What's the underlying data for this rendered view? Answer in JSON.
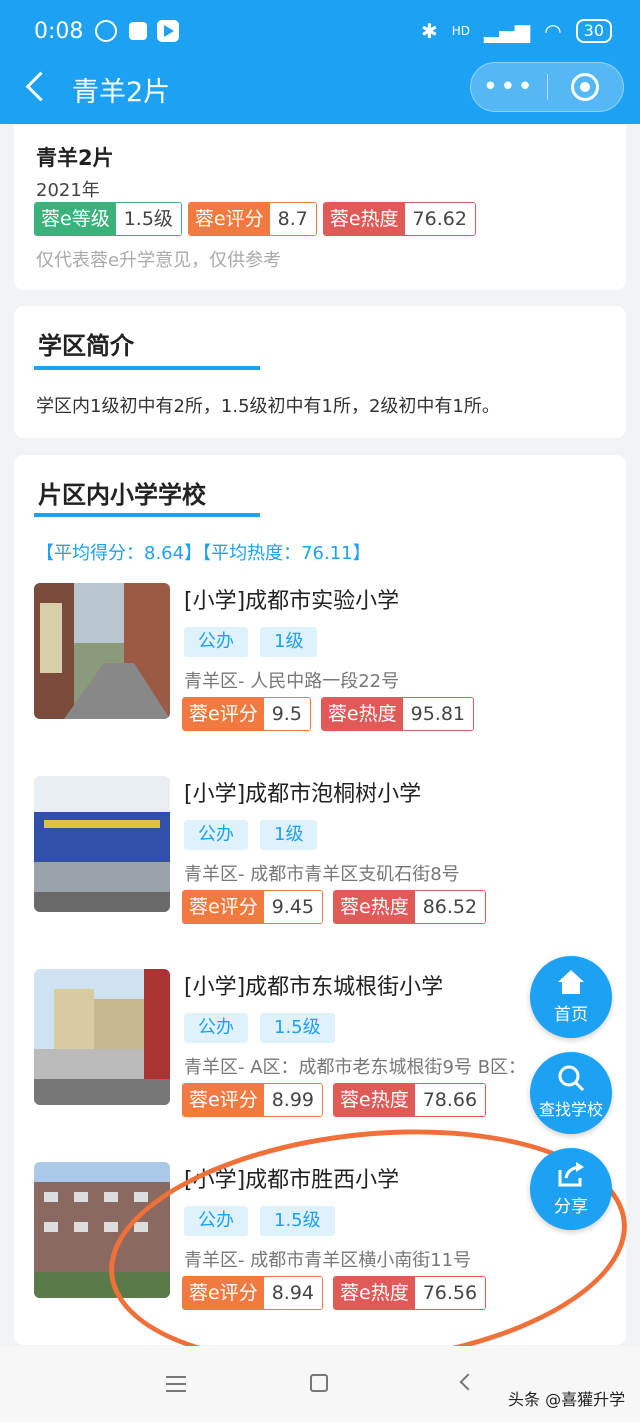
{
  "status_bar": {
    "time": "0:08",
    "network": "HD",
    "battery": "30"
  },
  "navbar": {
    "title": "青羊2片",
    "more_label": "•••"
  },
  "summary": {
    "title": "青羊2片",
    "year": "2021年",
    "badges": [
      {
        "key": "蓉e等级",
        "value": "1.5级"
      },
      {
        "key": "蓉e评分",
        "value": "8.7"
      },
      {
        "key": "蓉e热度",
        "value": "76.62"
      }
    ],
    "note": "仅代表蓉e升学意见，仅供参考"
  },
  "district_intro": {
    "title": "学区简介",
    "text": "学区内1级初中有2所，1.5级初中有1所，2级初中有1所。"
  },
  "primary_schools": {
    "title": "片区内小学学校",
    "average": "【平均得分：8.64】【平均热度：76.11】",
    "score_label": "蓉e评分",
    "heat_label": "蓉e热度",
    "items": [
      {
        "name": "[小学]成都市实验小学",
        "type": "公办",
        "level": "1级",
        "address": "青羊区- 人民中路一段22号",
        "score": "9.5",
        "heat": "95.81"
      },
      {
        "name": "[小学]成都市泡桐树小学",
        "type": "公办",
        "level": "1级",
        "address": "青羊区- 成都市青羊区支矶石街8号",
        "score": "9.45",
        "heat": "86.52"
      },
      {
        "name": "[小学]成都市东城根街小学",
        "type": "公办",
        "level": "1.5级",
        "address": "青羊区- A区：成都市老东城根街9号 B区：",
        "score": "8.99",
        "heat": "78.66"
      },
      {
        "name": "[小学]成都市胜西小学",
        "type": "公办",
        "level": "1.5级",
        "address": "青羊区- 成都市青羊区横小南街11号",
        "score": "8.94",
        "heat": "76.56"
      }
    ]
  },
  "floating": {
    "home": "首页",
    "search": "查找学校",
    "share": "分享"
  },
  "watermark": "头条 @喜獾升学",
  "colors": {
    "primary": "#1da1f2",
    "green": "#3bb17c",
    "orange": "#f07a40",
    "red": "#e05a58",
    "annotation": "#f0703a"
  }
}
